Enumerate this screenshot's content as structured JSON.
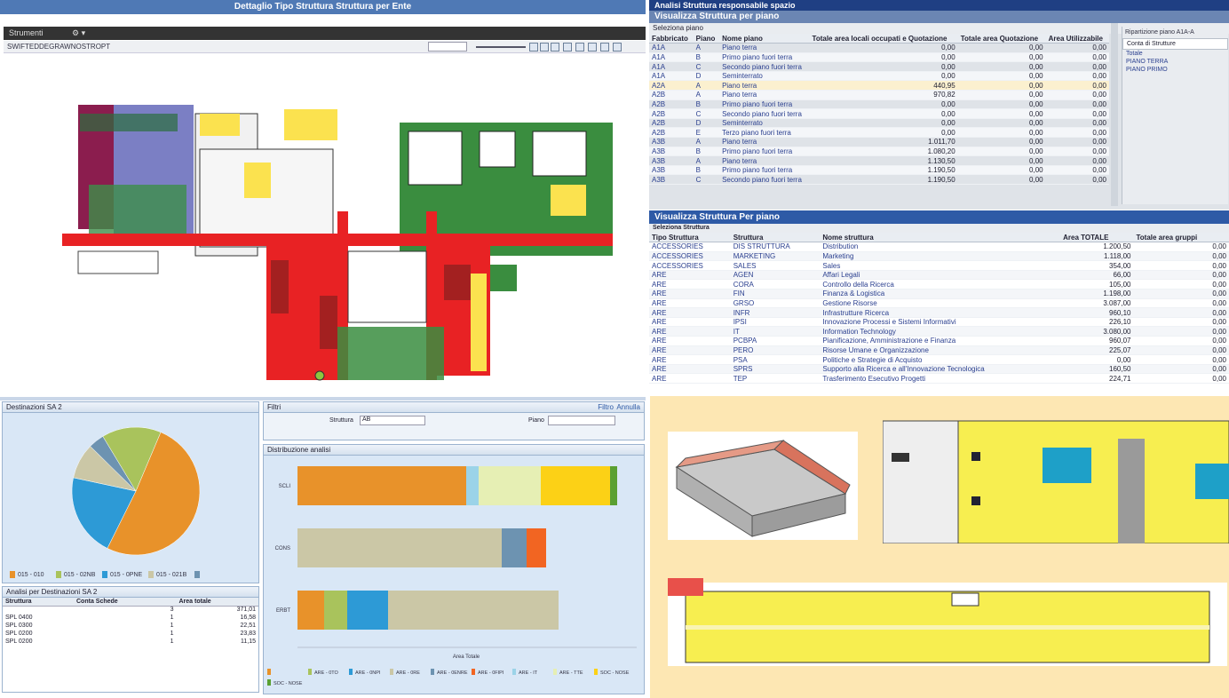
{
  "left_panel": {
    "title": "Dettaglio Tipo Struttura Struttura per Ente",
    "menubar": "Strumenti",
    "toolbar_label": "SWIFTEDDEGRAWNOSTROPT"
  },
  "pie_panel": {
    "title": "Destinazioni SA 2",
    "legend": [
      {
        "label": "015 - 010",
        "color": "#e8922a"
      },
      {
        "label": "015 - 02NB",
        "color": "#a9c35c"
      },
      {
        "label": "015 - 0PNE",
        "color": "#2d9ad6"
      },
      {
        "label": "015 - 021B",
        "color": "#cbc7a6"
      },
      {
        "label": "",
        "color": "#6d93b1"
      }
    ],
    "slices": [
      {
        "value": 51,
        "color": "#e8922a"
      },
      {
        "value": 21,
        "color": "#2d9ad6"
      },
      {
        "value": 9,
        "color": "#cbc7a6"
      },
      {
        "value": 4,
        "color": "#6d93b1"
      },
      {
        "value": 15,
        "color": "#a9c35c"
      }
    ]
  },
  "small_table": {
    "title": "Analisi per Destinazioni SA 2",
    "headers": [
      "Struttura",
      "Conta Schede",
      "Area totale"
    ],
    "rows": [
      [
        "",
        "3",
        "371,01"
      ],
      [
        "SPL 0400",
        "1",
        "16,58"
      ],
      [
        "SPL 0300",
        "1",
        "22,51"
      ],
      [
        "SPL 0200",
        "1",
        "23,83"
      ],
      [
        "SPL 0200",
        "1",
        "11,15"
      ]
    ]
  },
  "bar_panel": {
    "title": "Filtri",
    "filter_btn": "Filtro",
    "cancel_btn": "Annulla",
    "field1_label": "Struttura",
    "field1_value": "AB",
    "field2_label": "Piano",
    "chart_title": "Distribuzione analisi",
    "xlabel": "Area Totale",
    "categories": [
      "SCLI",
      "CONS",
      "ERBT"
    ],
    "legend": [
      {
        "label": "",
        "color": "#e8922a"
      },
      {
        "label": "ARE - 0TO",
        "color": "#a9c35c"
      },
      {
        "label": "ARE - 0NPI",
        "color": "#2d9ad6"
      },
      {
        "label": "ARE - 0RE",
        "color": "#cbc7a6"
      },
      {
        "label": "ARE - 0ENRE",
        "color": "#6d93b1"
      },
      {
        "label": "ARE - 0FIPI",
        "color": "#f26522"
      },
      {
        "label": "ARE - IT",
        "color": "#9bd3e8"
      },
      {
        "label": "ARE - TTE",
        "color": "#e6efb4"
      },
      {
        "label": "SOC - NOSE",
        "color": "#fcd116"
      },
      {
        "label": "SOC - NOSE",
        "color": "#5aa032"
      }
    ]
  },
  "top_right": {
    "header": "Analisi Struttura responsabile spazio",
    "title": "Visualizza Struttura per piano",
    "sub": "Seleziona piano",
    "side_header": "Ripartizione piano A1A-A",
    "side_columns": "Conta di Strutture",
    "side_rows": [
      "Totale",
      "PIANO TERRA",
      "PIANO PRIMO"
    ],
    "headers": [
      "Fabbricato",
      "Piano",
      "Nome piano",
      "Totale area locali occupati e Quotazione",
      "Totale area Quotazione",
      "Area Utilizzabile"
    ],
    "rows": [
      [
        "A1A",
        "A",
        "Piano terra",
        "0,00",
        "0,00",
        "0,00"
      ],
      [
        "A1A",
        "B",
        "Primo piano fuori terra",
        "0,00",
        "0,00",
        "0,00"
      ],
      [
        "A1A",
        "C",
        "Secondo piano fuori terra",
        "0,00",
        "0,00",
        "0,00"
      ],
      [
        "A1A",
        "D",
        "Seminterrato",
        "0,00",
        "0,00",
        "0,00"
      ],
      [
        "A2A",
        "A",
        "Piano terra",
        "440,95",
        "0,00",
        "0,00"
      ],
      [
        "A2B",
        "A",
        "Piano terra",
        "970,82",
        "0,00",
        "0,00"
      ],
      [
        "A2B",
        "B",
        "Primo piano fuori terra",
        "0,00",
        "0,00",
        "0,00"
      ],
      [
        "A2B",
        "C",
        "Secondo piano fuori terra",
        "0,00",
        "0,00",
        "0,00"
      ],
      [
        "A2B",
        "D",
        "Seminterrato",
        "0,00",
        "0,00",
        "0,00"
      ],
      [
        "A2B",
        "E",
        "Terzo piano fuori terra",
        "0,00",
        "0,00",
        "0,00"
      ],
      [
        "A3B",
        "A",
        "Piano terra",
        "1.011,70",
        "0,00",
        "0,00"
      ],
      [
        "A3B",
        "B",
        "Primo piano fuori terra",
        "1.080,20",
        "0,00",
        "0,00"
      ],
      [
        "A3B",
        "A",
        "Piano terra",
        "1.130,50",
        "0,00",
        "0,00"
      ],
      [
        "A3B",
        "B",
        "Primo piano fuori terra",
        "1.190,50",
        "0,00",
        "0,00"
      ],
      [
        "A3B",
        "C",
        "Secondo piano fuori terra",
        "1.190,50",
        "0,00",
        "0,00"
      ]
    ]
  },
  "mid_right": {
    "title": "Visualizza Struttura Per piano",
    "sub": "Seleziona Struttura",
    "headers": [
      "Tipo Struttura",
      "Struttura",
      "Nome struttura",
      "Area TOTALE",
      "Totale area gruppi"
    ],
    "rows": [
      [
        "ACCESSORIES",
        "DIS STRUTTURA",
        "Distribution",
        "1.200,50",
        "0,00"
      ],
      [
        "ACCESSORIES",
        "MARKETING",
        "Marketing",
        "1.118,00",
        "0,00"
      ],
      [
        "ACCESSORIES",
        "SALES",
        "Sales",
        "354,00",
        "0,00"
      ],
      [
        "ARE",
        "AGEN",
        "Affari Legali",
        "66,00",
        "0,00"
      ],
      [
        "ARE",
        "CORA",
        "Controllo della Ricerca",
        "105,00",
        "0,00"
      ],
      [
        "ARE",
        "FIN",
        "Finanza & Logistica",
        "1.198,00",
        "0,00"
      ],
      [
        "ARE",
        "GRSO",
        "Gestione Risorse",
        "3.087,00",
        "0,00"
      ],
      [
        "ARE",
        "INFR",
        "Infrastrutture Ricerca",
        "960,10",
        "0,00"
      ],
      [
        "ARE",
        "IPSI",
        "Innovazione Processi e Sistemi Informativi",
        "226,10",
        "0,00"
      ],
      [
        "ARE",
        "IT",
        "Information Technology",
        "3.080,00",
        "0,00"
      ],
      [
        "ARE",
        "PCBPA",
        "Pianificazione, Amministrazione e Finanza",
        "960,07",
        "0,00"
      ],
      [
        "ARE",
        "PERO",
        "Risorse Umane e Organizzazione",
        "225,07",
        "0,00"
      ],
      [
        "ARE",
        "PSA",
        "Politiche e Strategie di Acquisto",
        "0,00",
        "0,00"
      ],
      [
        "ARE",
        "SPRS",
        "Supporto alla Ricerca e all'Innovazione Tecnologica",
        "160,50",
        "0,00"
      ],
      [
        "ARE",
        "TEP",
        "Trasferimento Esecutivo Progetti",
        "224,71",
        "0,00"
      ]
    ]
  },
  "colors": {
    "accent": "#2e5aa6",
    "panel_bg": "#d9e7f6",
    "plan_yellow": "#fbee4f"
  }
}
